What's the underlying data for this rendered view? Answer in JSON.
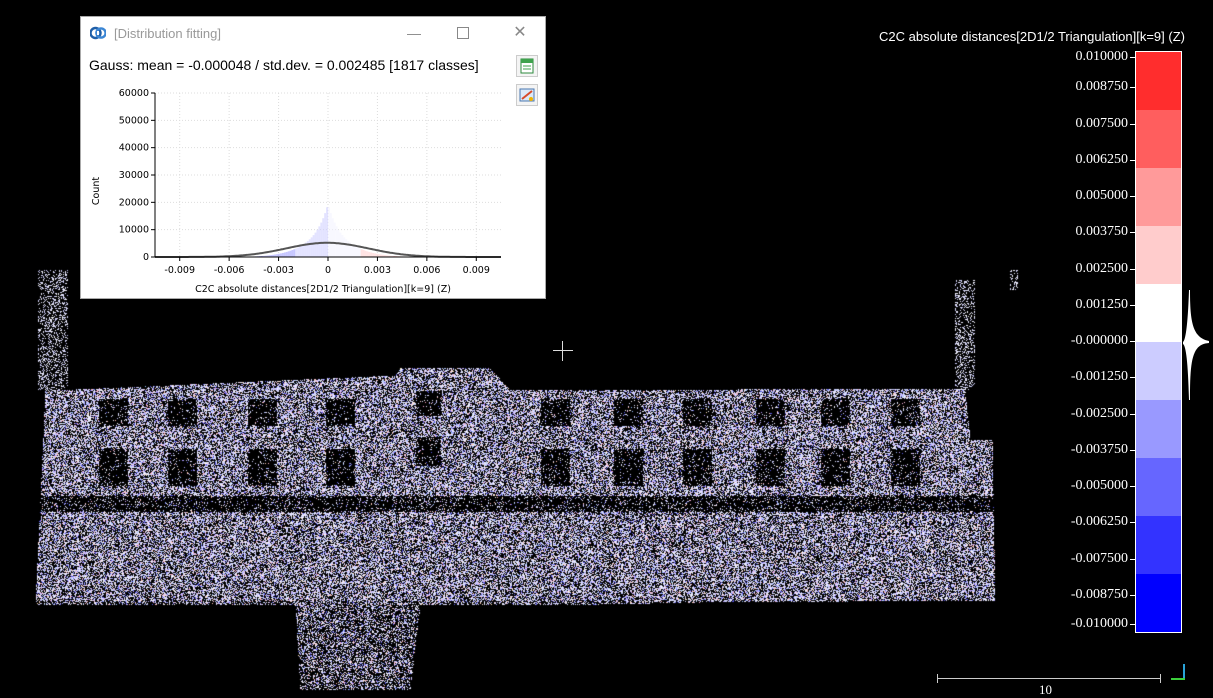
{
  "dialog": {
    "title": "[Distribution fitting]",
    "window_controls": {
      "minimize": "—",
      "close": "✕"
    },
    "info": "Gauss: mean = -0.000048 / std.dev. = 0.002485 [1817 classes]",
    "buttons": {
      "export_csv": "export-csv-icon",
      "export_image": "export-image-icon"
    },
    "plot": {
      "ylabel": "Count",
      "xlabel": "C2C absolute distances[2D1/2 Triangulation][k=9] (Z)",
      "y_ticks": [
        "0",
        "10000",
        "20000",
        "30000",
        "40000",
        "50000",
        "60000"
      ],
      "x_ticks": [
        "-0.009",
        "-0.006",
        "-0.003",
        "0",
        "0.003",
        "0.006",
        "0.009"
      ]
    }
  },
  "chart_data": {
    "type": "area",
    "title": "",
    "xlabel": "C2C absolute distances[2D1/2 Triangulation][k=9] (Z)",
    "ylabel": "Count",
    "xlim": [
      -0.0105,
      0.0105
    ],
    "ylim": [
      0,
      60000
    ],
    "grid": true,
    "histogram_peak": {
      "x": 0,
      "y": 16000
    },
    "gauss": {
      "mean": -4.8e-05,
      "std": 0.002485,
      "peak": 5200
    }
  },
  "scalebar": {
    "title": "C2C absolute distances[2D1/2 Triangulation][k=9] (Z)",
    "ticks": [
      "0.010000",
      "0.008750",
      "0.007500",
      "0.006250",
      "0.005000",
      "0.003750",
      "0.002500",
      "0.001250",
      "-0.000000",
      "-0.001250",
      "-0.002500",
      "-0.003750",
      "-0.005000",
      "-0.006250",
      "-0.007500",
      "-0.008750",
      "-0.010000"
    ],
    "colors": [
      "#ff2d2d",
      "#ff5e5e",
      "#ff9a9a",
      "#ffcccc",
      "#ffffff",
      "#ccccff",
      "#9999ff",
      "#6666ff",
      "#3333ff",
      "#0000ff"
    ]
  },
  "graphical_scale": {
    "label": "10"
  }
}
